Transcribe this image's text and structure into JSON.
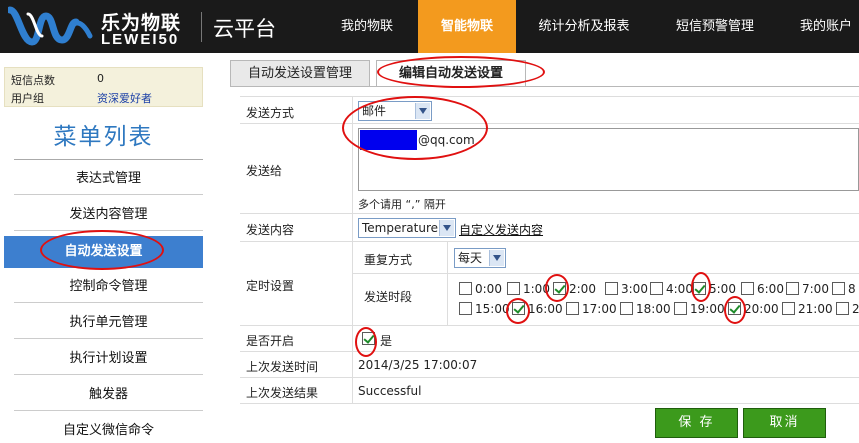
{
  "header": {
    "logo_cn": "乐为物联",
    "logo_en": "LEWEI50",
    "cloud_label": "云平台",
    "nav": [
      {
        "label": "我的物联",
        "active": false
      },
      {
        "label": "智能物联",
        "active": true
      },
      {
        "label": "统计分析及报表",
        "active": false
      },
      {
        "label": "短信预警管理",
        "active": false
      },
      {
        "label": "我的账户",
        "active": false
      }
    ],
    "colors": {
      "bar": "#1a1a1a",
      "active": "#f39a1e"
    }
  },
  "sidebar": {
    "info": {
      "sms_label": "短信点数",
      "sms_value": "0",
      "group_label": "用户组",
      "group_value": "资深爱好者"
    },
    "menu_title": "菜单列表",
    "items": [
      {
        "label": "表达式管理",
        "active": false
      },
      {
        "label": "发送内容管理",
        "active": false
      },
      {
        "label": "自动发送设置",
        "active": true
      },
      {
        "label": "控制命令管理",
        "active": false
      },
      {
        "label": "执行单元管理",
        "active": false
      },
      {
        "label": "执行计划设置",
        "active": false
      },
      {
        "label": "触发器",
        "active": false
      },
      {
        "label": "自定义微信命令",
        "active": false
      }
    ]
  },
  "tabs": [
    {
      "label": "自动发送设置管理",
      "active": false
    },
    {
      "label": "编辑自动发送设置",
      "active": true
    }
  ],
  "form": {
    "method_label": "发送方式",
    "method_value": "邮件",
    "send_to_label": "发送给",
    "send_to_suffix": "@qq.com",
    "send_to_hint": "多个请用 “,” 隔开",
    "content_label": "发送内容",
    "content_value": "Temperature",
    "content_link": "自定义发送内容",
    "schedule_label": "定时设置",
    "repeat_label": "重复方式",
    "repeat_value": "每天",
    "time_label": "发送时段",
    "times_row1": [
      {
        "label": "0:00",
        "checked": false
      },
      {
        "label": "1:00",
        "checked": false
      },
      {
        "label": "2:00",
        "checked": true
      },
      {
        "label": "3:00",
        "checked": false
      },
      {
        "label": "4:00",
        "checked": false
      },
      {
        "label": "5:00",
        "checked": true
      },
      {
        "label": "6:00",
        "checked": false
      },
      {
        "label": "7:00",
        "checked": false
      },
      {
        "label": "8",
        "checked": false
      }
    ],
    "times_row2": [
      {
        "label": "15:00",
        "checked": false
      },
      {
        "label": "16:00",
        "checked": true
      },
      {
        "label": "17:00",
        "checked": false
      },
      {
        "label": "18:00",
        "checked": false
      },
      {
        "label": "19:00",
        "checked": false
      },
      {
        "label": "20:00",
        "checked": true
      },
      {
        "label": "21:00",
        "checked": false
      },
      {
        "label": "2",
        "checked": false
      }
    ],
    "enabled_label": "是否开启",
    "enabled_option": "是",
    "enabled": true,
    "last_time_label": "上次发送时间",
    "last_time_value": "2014/3/25 17:00:07",
    "last_result_label": "上次发送结果",
    "last_result_value": "Successful",
    "save_label": "保 存",
    "cancel_label": "取消"
  }
}
